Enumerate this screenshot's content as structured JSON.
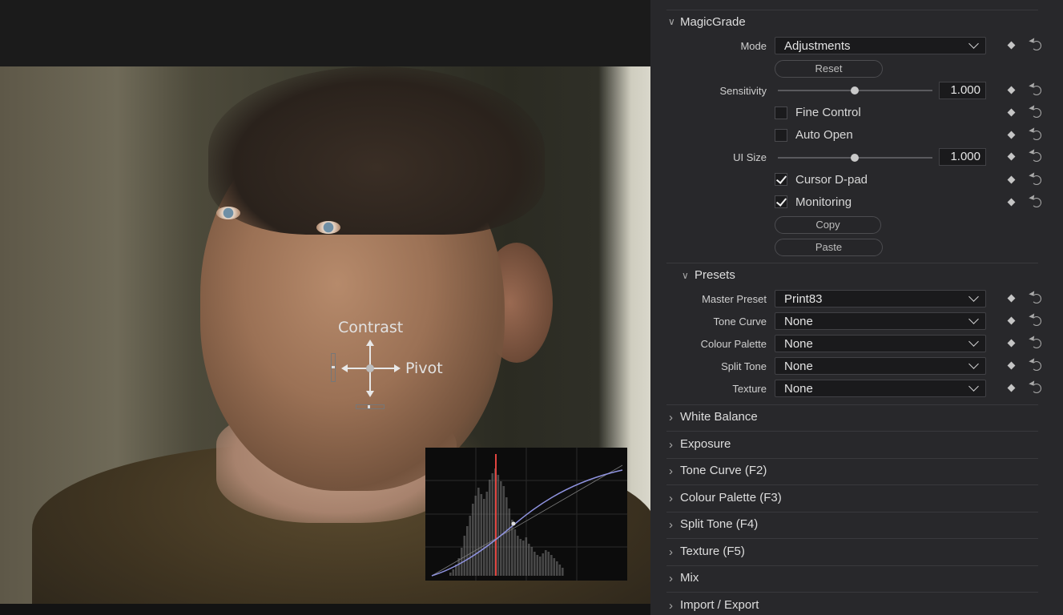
{
  "overlay": {
    "contrast_label": "Contrast",
    "pivot_label": "Pivot"
  },
  "inspector": {
    "magicgrade": {
      "title": "MagicGrade",
      "mode_label": "Mode",
      "mode_value": "Adjustments",
      "reset_label": "Reset",
      "sensitivity_label": "Sensitivity",
      "sensitivity_value": "1.000",
      "fine_control_label": "Fine Control",
      "fine_control_checked": false,
      "auto_open_label": "Auto Open",
      "auto_open_checked": false,
      "ui_size_label": "UI Size",
      "ui_size_value": "1.000",
      "cursor_dpad_label": "Cursor D-pad",
      "cursor_dpad_checked": true,
      "monitoring_label": "Monitoring",
      "monitoring_checked": true,
      "copy_label": "Copy",
      "paste_label": "Paste"
    },
    "presets": {
      "title": "Presets",
      "rows": [
        {
          "label": "Master Preset",
          "value": "Print83"
        },
        {
          "label": "Tone Curve",
          "value": "None"
        },
        {
          "label": "Colour Palette",
          "value": "None"
        },
        {
          "label": "Split Tone",
          "value": "None"
        },
        {
          "label": "Texture",
          "value": "None"
        }
      ]
    },
    "sections": [
      "White Balance",
      "Exposure",
      "Tone Curve (F2)",
      "Colour Palette (F3)",
      "Split Tone (F4)",
      "Texture (F5)",
      "Mix",
      "Import / Export"
    ]
  },
  "colors": {
    "panel_bg": "#28282b",
    "curve_line": "#8f93e0",
    "pivot_line": "#e0443f"
  },
  "icons": [
    "chevron-down-icon",
    "chevron-right-icon",
    "keyframe-diamond-icon",
    "reset-icon",
    "checkmark-icon"
  ]
}
